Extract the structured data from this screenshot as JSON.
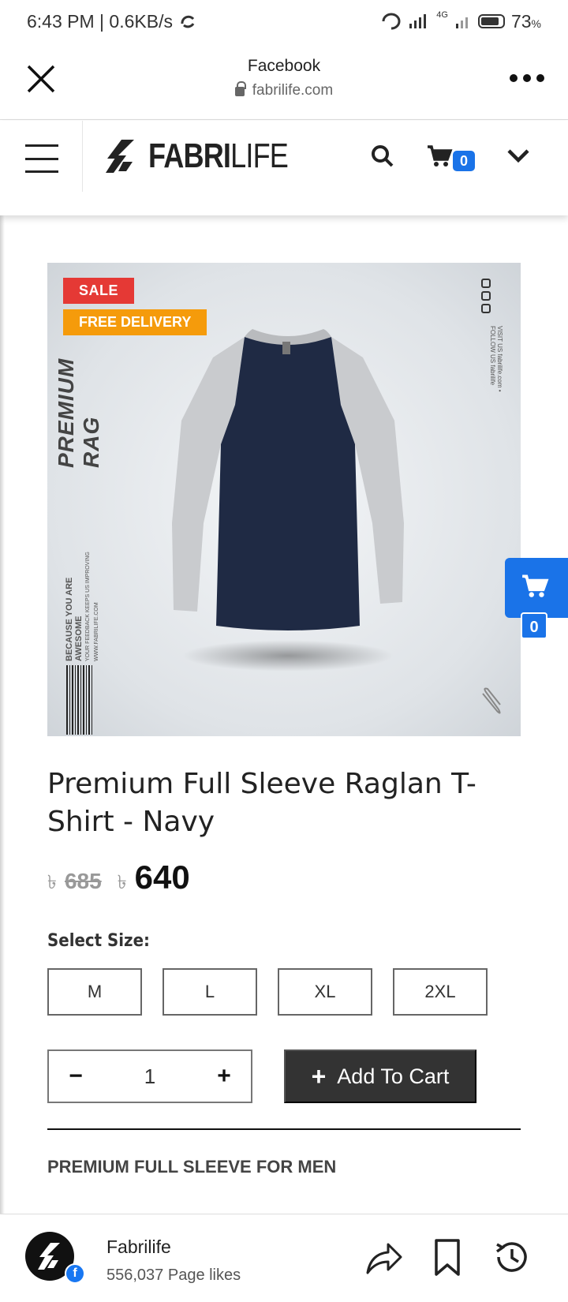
{
  "status_bar": {
    "time_network": "6:43 PM | 0.6KB/s",
    "network_type": "4G",
    "battery_pct": "73",
    "battery_unit": "%"
  },
  "browser": {
    "title": "Facebook",
    "url": "fabrilife.com"
  },
  "site_header": {
    "logo_bold": "FABRI",
    "logo_light": "LIFE",
    "cart_count": "0"
  },
  "product": {
    "badges": {
      "sale": "SALE",
      "delivery": "FREE DELIVERY"
    },
    "image_text": {
      "vertical_brand": "PREMIUM RAG",
      "tagline": "BECAUSE YOU ARE AWESOME",
      "tagline_sub": "YOUR FEEDBACK KEEPS US IMPROVING",
      "tagline_url": "WWW.FABRILIFE.COM",
      "follow_text": "VISIT US fabrilife.com • FOLLOW US fabrilife"
    },
    "title": "Premium Full Sleeve Raglan T-Shirt - Navy",
    "currency": "৳",
    "old_price": "685",
    "new_price": "640",
    "size_label": "Select Size:",
    "sizes": [
      "M",
      "L",
      "XL",
      "2XL"
    ],
    "quantity": "1",
    "qty_minus": "−",
    "qty_plus": "+",
    "add_to_cart": "Add To Cart",
    "section_heading": "PREMIUM FULL SLEEVE FOR MEN"
  },
  "floating_cart": {
    "count": "0"
  },
  "bottom_bar": {
    "page_name": "Fabrilife",
    "page_likes": "556,037 Page likes"
  },
  "colors": {
    "accent_blue": "#1a73e8",
    "sale_red": "#e53935",
    "delivery_orange": "#f59b0b",
    "button_dark": "#333333",
    "shirt_navy": "#1f2a44",
    "shirt_sleeve_grey": "#c9cbce"
  }
}
